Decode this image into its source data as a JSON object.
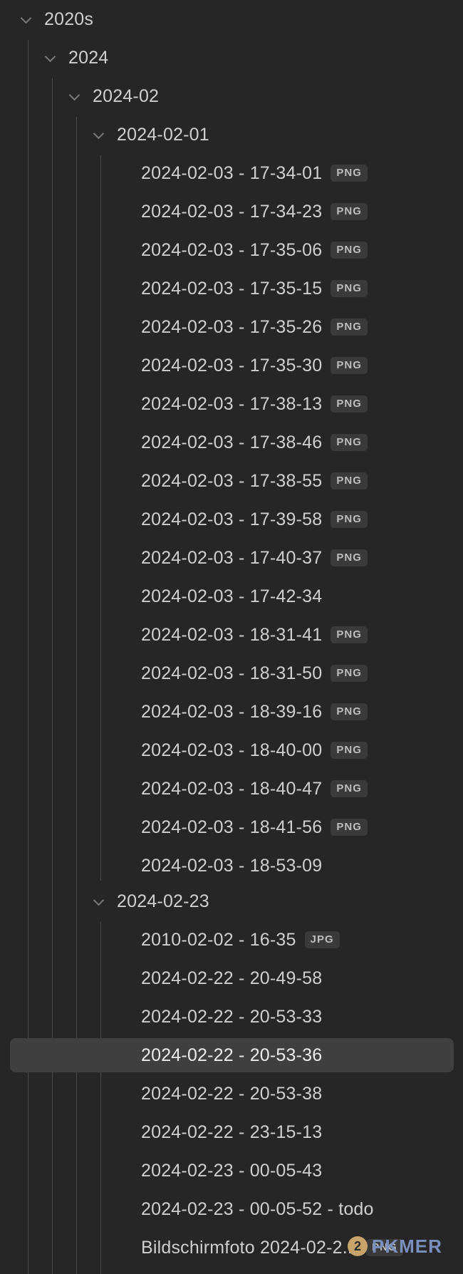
{
  "tree": {
    "folders": {
      "decade": "2020s",
      "year": "2024",
      "month": "2024-02",
      "day1": "2024-02-01",
      "day2": "2024-02-23"
    },
    "group1": [
      {
        "name": "2024-02-03 - 17-34-01",
        "badge": "PNG"
      },
      {
        "name": "2024-02-03 - 17-34-23",
        "badge": "PNG"
      },
      {
        "name": "2024-02-03 - 17-35-06",
        "badge": "PNG"
      },
      {
        "name": "2024-02-03 - 17-35-15",
        "badge": "PNG"
      },
      {
        "name": "2024-02-03 - 17-35-26",
        "badge": "PNG"
      },
      {
        "name": "2024-02-03 - 17-35-30",
        "badge": "PNG"
      },
      {
        "name": "2024-02-03 - 17-38-13",
        "badge": "PNG"
      },
      {
        "name": "2024-02-03 - 17-38-46",
        "badge": "PNG"
      },
      {
        "name": "2024-02-03 - 17-38-55",
        "badge": "PNG"
      },
      {
        "name": "2024-02-03 - 17-39-58",
        "badge": "PNG"
      },
      {
        "name": "2024-02-03 - 17-40-37",
        "badge": "PNG"
      },
      {
        "name": "2024-02-03 - 17-42-34",
        "badge": ""
      },
      {
        "name": "2024-02-03 - 18-31-41",
        "badge": "PNG"
      },
      {
        "name": "2024-02-03 - 18-31-50",
        "badge": "PNG"
      },
      {
        "name": "2024-02-03 - 18-39-16",
        "badge": "PNG"
      },
      {
        "name": "2024-02-03 - 18-40-00",
        "badge": "PNG"
      },
      {
        "name": "2024-02-03 - 18-40-47",
        "badge": "PNG"
      },
      {
        "name": "2024-02-03 - 18-41-56",
        "badge": "PNG"
      },
      {
        "name": "2024-02-03 - 18-53-09",
        "badge": ""
      }
    ],
    "group2": [
      {
        "name": "2010-02-02 - 16-35",
        "badge": "JPG"
      },
      {
        "name": "2024-02-22 - 20-49-58",
        "badge": ""
      },
      {
        "name": "2024-02-22 - 20-53-33",
        "badge": ""
      },
      {
        "name": "2024-02-22 - 20-53-36",
        "badge": "",
        "selected": true
      },
      {
        "name": "2024-02-22 - 20-53-38",
        "badge": ""
      },
      {
        "name": "2024-02-22 - 23-15-13",
        "badge": ""
      },
      {
        "name": "2024-02-23 - 00-05-43",
        "badge": ""
      },
      {
        "name": "2024-02-23 - 00-05-52 - todo",
        "badge": ""
      },
      {
        "name": "Bildschirmfoto 2024-02-2...",
        "badge": "PNG"
      }
    ]
  },
  "watermark": {
    "mark": "2",
    "text": "PKMER"
  }
}
